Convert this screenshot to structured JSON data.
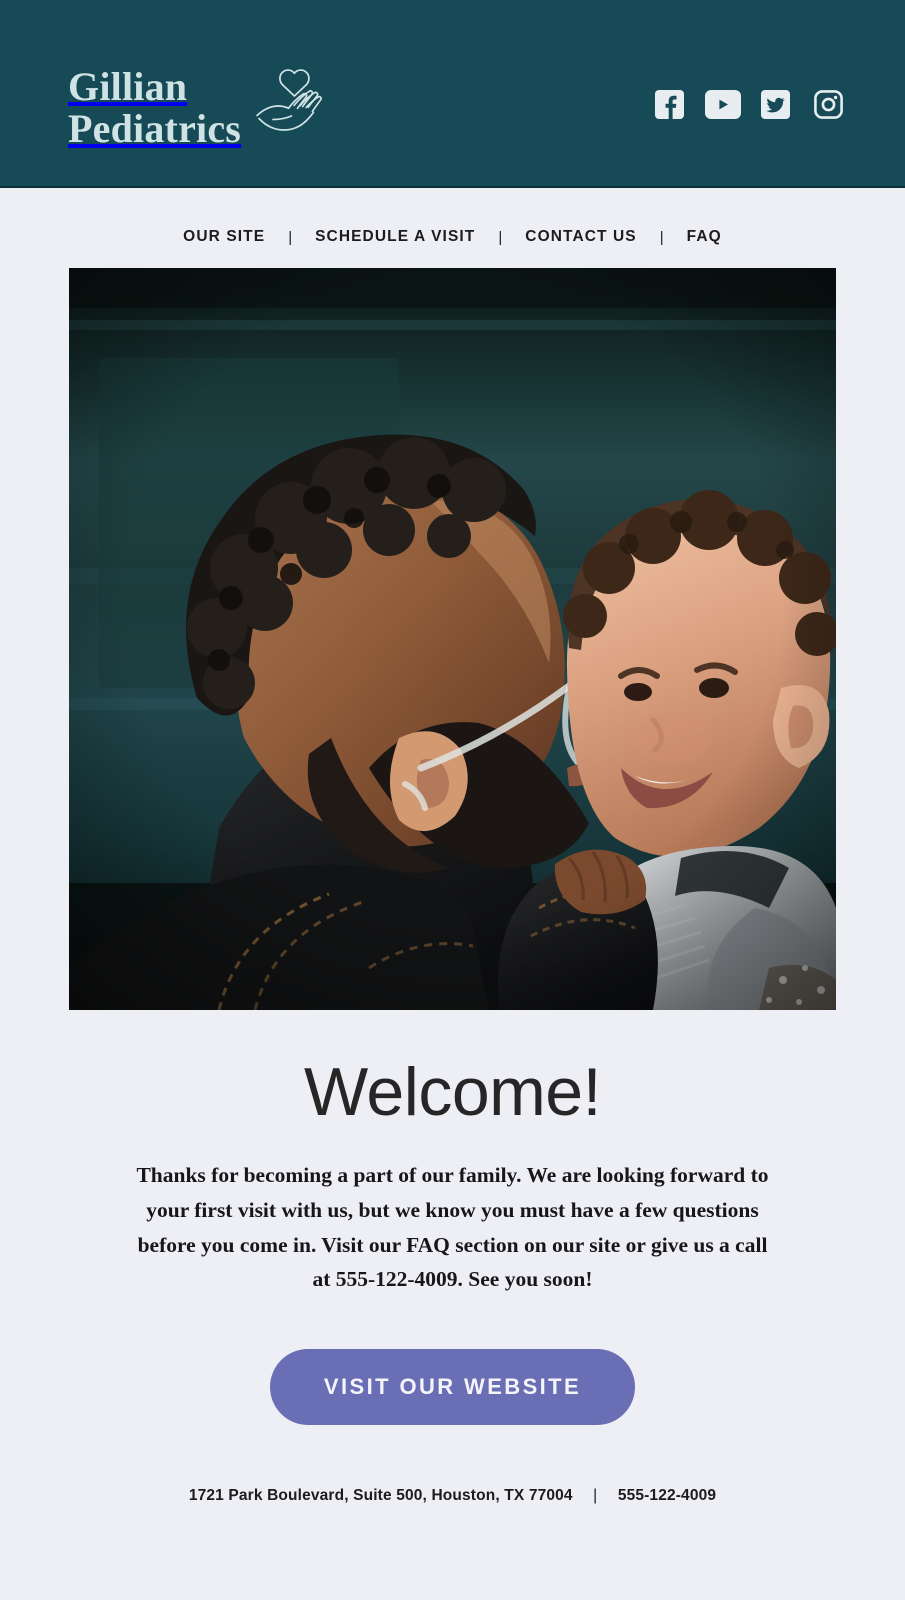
{
  "theme": {
    "header_bg": "#164a56",
    "page_bg": "#eeeef5",
    "logo_color": "#cfe3e4",
    "accent_button": "#6a6eb4",
    "text_dark": "#1c1c1c"
  },
  "header": {
    "brand_line1": "Gillian",
    "brand_line2": "Pediatrics",
    "logo_icon": "hand-holding-heart-icon",
    "social": [
      {
        "name": "facebook",
        "label": "Facebook",
        "icon": "facebook-icon"
      },
      {
        "name": "youtube",
        "label": "YouTube",
        "icon": "youtube-icon"
      },
      {
        "name": "twitter",
        "label": "Twitter",
        "icon": "twitter-icon"
      },
      {
        "name": "instagram",
        "label": "Instagram",
        "icon": "instagram-icon"
      }
    ]
  },
  "nav": {
    "separator": "|",
    "items": [
      {
        "label": "OUR SITE"
      },
      {
        "label": "SCHEDULE A VISIT"
      },
      {
        "label": "CONTACT US"
      },
      {
        "label": "FAQ"
      }
    ]
  },
  "hero": {
    "alt": "Father with glasses kissing smiling toddler on the cheek in front of a dark teal door"
  },
  "main": {
    "heading": "Welcome!",
    "body": "Thanks for becoming a part of our family. We are looking forward to your first visit with us, but we know you must have a few questions before you come in. Visit our FAQ section on our site or give us a call at 555-122-4009. See you soon!",
    "cta_label": "VISIT OUR WEBSITE"
  },
  "footer": {
    "address": "1721 Park Boulevard, Suite 500, Houston, TX 77004",
    "separator": "|",
    "phone": "555-122-4009"
  }
}
